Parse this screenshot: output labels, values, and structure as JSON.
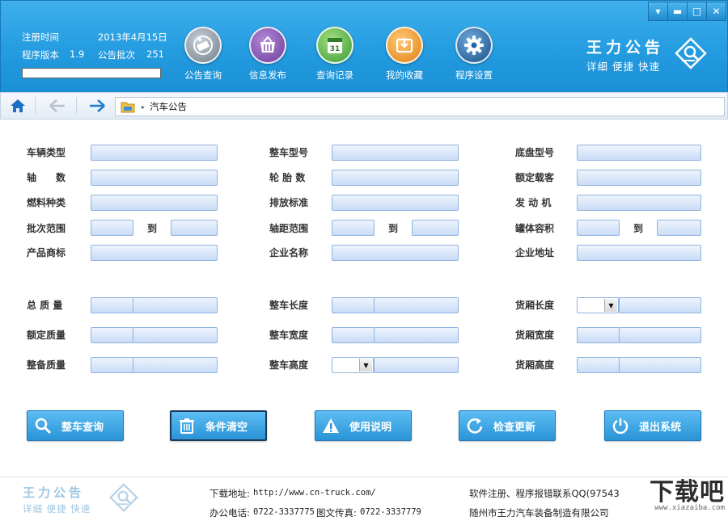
{
  "header": {
    "reg_time_label": "注册时间",
    "reg_time_value": "2013年4月15日",
    "version_label": "程序版本",
    "version_value": "1.9",
    "batch_label": "公告批次",
    "batch_value": "251",
    "nav": [
      {
        "label": "公告查询",
        "icon": "announcement-search-icon",
        "color": "#7d8a96"
      },
      {
        "label": "信息发布",
        "icon": "basket-icon",
        "color": "#8a54b8"
      },
      {
        "label": "查询记录",
        "icon": "calendar-icon",
        "color": "#4eb04a"
      },
      {
        "label": "我的收藏",
        "icon": "favorites-box-icon",
        "color": "#f19a28"
      },
      {
        "label": "程序设置",
        "icon": "gear-icon",
        "color": "#1d67aa"
      }
    ],
    "logo_title": "王力公告",
    "logo_subtitle": "详细 便捷 快速",
    "window_controls": {
      "menu": "▾",
      "minimize": "▬",
      "maximize": "□",
      "close": "✕"
    }
  },
  "addressbar": {
    "breadcrumb_sep": "▸",
    "breadcrumb": "汽车公告"
  },
  "form": {
    "to_label": "到",
    "fields": {
      "vehicle_type": "车辆类型",
      "complete_model": "整车型号",
      "chassis_model": "底盘型号",
      "axle_count": "轴　　数",
      "tire_count": "轮 胎 数",
      "rated_passengers": "额定载客",
      "fuel_type": "燃料种类",
      "emission_std": "排放标准",
      "engine": "发 动 机",
      "batch_range": "批次范围",
      "wheelbase_range": "轴距范围",
      "tank_volume": "罐体容积",
      "brand": "产品商标",
      "company_name": "企业名称",
      "company_address": "企业地址",
      "total_mass": "总 质 量",
      "vehicle_length": "整车长度",
      "cargo_length": "货厢长度",
      "rated_mass": "额定质量",
      "vehicle_width": "整车宽度",
      "cargo_width": "货厢宽度",
      "curb_mass": "整备质量",
      "vehicle_height": "整车高度",
      "cargo_height": "货厢高度"
    },
    "dropdown_arrow": "▼"
  },
  "buttons": [
    {
      "label": "整车查询",
      "icon": "magnifier-icon"
    },
    {
      "label": "条件清空",
      "icon": "trash-icon"
    },
    {
      "label": "使用说明",
      "icon": "warning-icon"
    },
    {
      "label": "检查更新",
      "icon": "refresh-icon"
    },
    {
      "label": "退出系统",
      "icon": "power-icon"
    }
  ],
  "footer": {
    "logo_title": "王力公告",
    "logo_subtitle": "详细 便捷 快速",
    "download_label": "下载地址:",
    "download_url": "http://www.cn-truck.com/",
    "phone_label": "办公电话:",
    "phone_value": "0722-3337775",
    "fax_label": "图文传真:",
    "fax_value": "0722-3337779",
    "register_text": "软件注册、程序报错联系QQ(97543",
    "company_text": "随州市王力汽车装备制造有限公司",
    "watermark_text": "下载吧",
    "watermark_url": "www.xiazaiba.com"
  },
  "colors": {
    "header_blue": "#249ce0",
    "field_blue": "#c9dcf6",
    "button_blue": "#2a93d7"
  }
}
